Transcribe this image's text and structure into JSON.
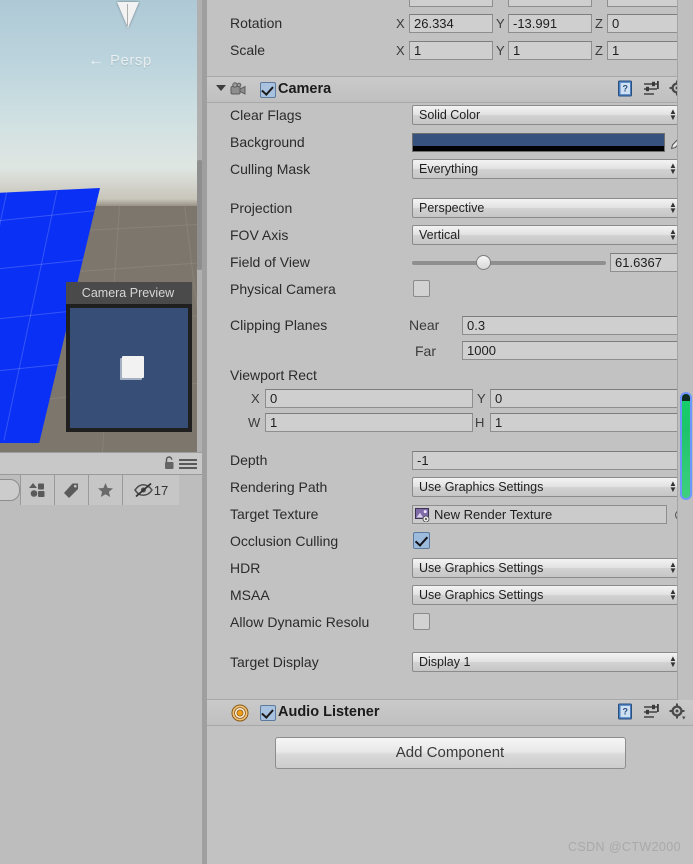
{
  "scene": {
    "gizmo_label": "Persp",
    "gizmo_arrow": "←",
    "camera_preview_title": "Camera Preview",
    "visibility_count": "17",
    "icons": {
      "lock": "lock-icon",
      "menu": "hamburger-menu-icon",
      "layers": "layers-icon",
      "tag": "tag-icon",
      "favorite": "star-icon",
      "visibility": "eye-off-icon"
    }
  },
  "inspector": {
    "transform": {
      "rows": [
        {
          "label": "Rotation",
          "x": "26.334",
          "y": "-13.991",
          "z": "0"
        },
        {
          "label": "Scale",
          "x": "1",
          "y": "1",
          "z": "1"
        }
      ],
      "axis_x": "X",
      "axis_y": "Y",
      "axis_z": "Z"
    },
    "camera": {
      "title": "Camera",
      "enabled": true,
      "icon": "camera-icon",
      "header_icons": [
        "help-icon",
        "preset-icon",
        "gear-icon"
      ],
      "clear_flags": {
        "label": "Clear Flags",
        "value": "Solid Color"
      },
      "background": {
        "label": "Background",
        "color": "#37517f",
        "alpha_color": "#000000"
      },
      "culling_mask": {
        "label": "Culling Mask",
        "value": "Everything"
      },
      "projection": {
        "label": "Projection",
        "value": "Perspective"
      },
      "fov_axis": {
        "label": "FOV Axis",
        "value": "Vertical"
      },
      "field_of_view": {
        "label": "Field of View",
        "value": "61.6367",
        "slider_percent": 33
      },
      "physical_camera": {
        "label": "Physical Camera",
        "checked": false
      },
      "clipping_planes": {
        "label": "Clipping Planes",
        "near_label": "Near",
        "near": "0.3",
        "far_label": "Far",
        "far": "1000"
      },
      "viewport_rect": {
        "label": "Viewport Rect",
        "x_label": "X",
        "x": "0",
        "y_label": "Y",
        "y": "0",
        "w_label": "W",
        "w": "1",
        "h_label": "H",
        "h": "1"
      },
      "depth": {
        "label": "Depth",
        "value": "-1"
      },
      "rendering_path": {
        "label": "Rendering Path",
        "value": "Use Graphics Settings"
      },
      "target_texture": {
        "label": "Target Texture",
        "value": "New Render Texture"
      },
      "occlusion_culling": {
        "label": "Occlusion Culling",
        "checked": true
      },
      "hdr": {
        "label": "HDR",
        "value": "Use Graphics Settings"
      },
      "msaa": {
        "label": "MSAA",
        "value": "Use Graphics Settings"
      },
      "allow_dynamic_resolution": {
        "label": "Allow Dynamic Resolu",
        "checked": false
      },
      "target_display": {
        "label": "Target Display",
        "value": "Display 1"
      }
    },
    "audio_listener": {
      "title": "Audio Listener",
      "enabled": true,
      "icon": "audio-listener-icon",
      "header_icons": [
        "help-icon",
        "preset-icon",
        "gear-icon"
      ]
    },
    "add_component": "Add Component"
  },
  "watermark": "CSDN @CTW2000"
}
